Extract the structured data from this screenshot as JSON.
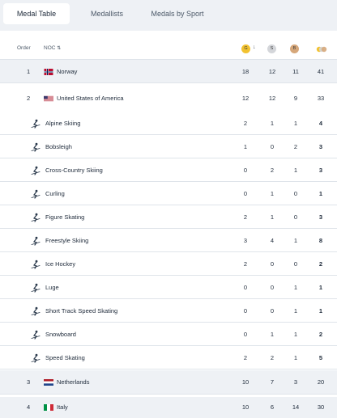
{
  "tabs": [
    "Medal Table",
    "Medallists",
    "Medals by Sport"
  ],
  "header": {
    "order": "Order",
    "noc": "NOC",
    "gold": "G",
    "silver": "S",
    "bronze": "B"
  },
  "countries": [
    {
      "order": "1",
      "name": "Norway",
      "gold": "18",
      "silver": "12",
      "bronze": "11",
      "total": "41",
      "flag": "norway"
    },
    {
      "order": "2",
      "name": "United States of America",
      "gold": "12",
      "silver": "12",
      "bronze": "9",
      "total": "33",
      "flag": "usa"
    },
    {
      "order": "3",
      "name": "Netherlands",
      "gold": "10",
      "silver": "7",
      "bronze": "3",
      "total": "20",
      "flag": "netherlands"
    },
    {
      "order": "4",
      "name": "Italy",
      "gold": "10",
      "silver": "6",
      "bronze": "14",
      "total": "30",
      "flag": "italy"
    }
  ],
  "sports": [
    {
      "name": "Alpine Skiing",
      "gold": "2",
      "silver": "1",
      "bronze": "1",
      "total": "4",
      "icon": "alpine-skiing-icon"
    },
    {
      "name": "Bobsleigh",
      "gold": "1",
      "silver": "0",
      "bronze": "2",
      "total": "3",
      "icon": "bobsleigh-icon"
    },
    {
      "name": "Cross-Country Skiing",
      "gold": "0",
      "silver": "2",
      "bronze": "1",
      "total": "3",
      "icon": "cross-country-skiing-icon"
    },
    {
      "name": "Curling",
      "gold": "0",
      "silver": "1",
      "bronze": "0",
      "total": "1",
      "icon": "curling-icon"
    },
    {
      "name": "Figure Skating",
      "gold": "2",
      "silver": "1",
      "bronze": "0",
      "total": "3",
      "icon": "figure-skating-icon"
    },
    {
      "name": "Freestyle Skiing",
      "gold": "3",
      "silver": "4",
      "bronze": "1",
      "total": "8",
      "icon": "freestyle-skiing-icon"
    },
    {
      "name": "Ice Hockey",
      "gold": "2",
      "silver": "0",
      "bronze": "0",
      "total": "2",
      "icon": "ice-hockey-icon"
    },
    {
      "name": "Luge",
      "gold": "0",
      "silver": "0",
      "bronze": "1",
      "total": "1",
      "icon": "luge-icon"
    },
    {
      "name": "Short Track Speed Skating",
      "gold": "0",
      "silver": "0",
      "bronze": "1",
      "total": "1",
      "icon": "short-track-icon"
    },
    {
      "name": "Snowboard",
      "gold": "0",
      "silver": "1",
      "bronze": "1",
      "total": "2",
      "icon": "snowboard-icon"
    },
    {
      "name": "Speed Skating",
      "gold": "2",
      "silver": "2",
      "bronze": "1",
      "total": "5",
      "icon": "speed-skating-icon"
    }
  ],
  "colors": {
    "gold": "#f2c230",
    "silver": "#d4d6da",
    "bronze": "#d6a77a",
    "rowHighlight": "#eef1f5"
  }
}
